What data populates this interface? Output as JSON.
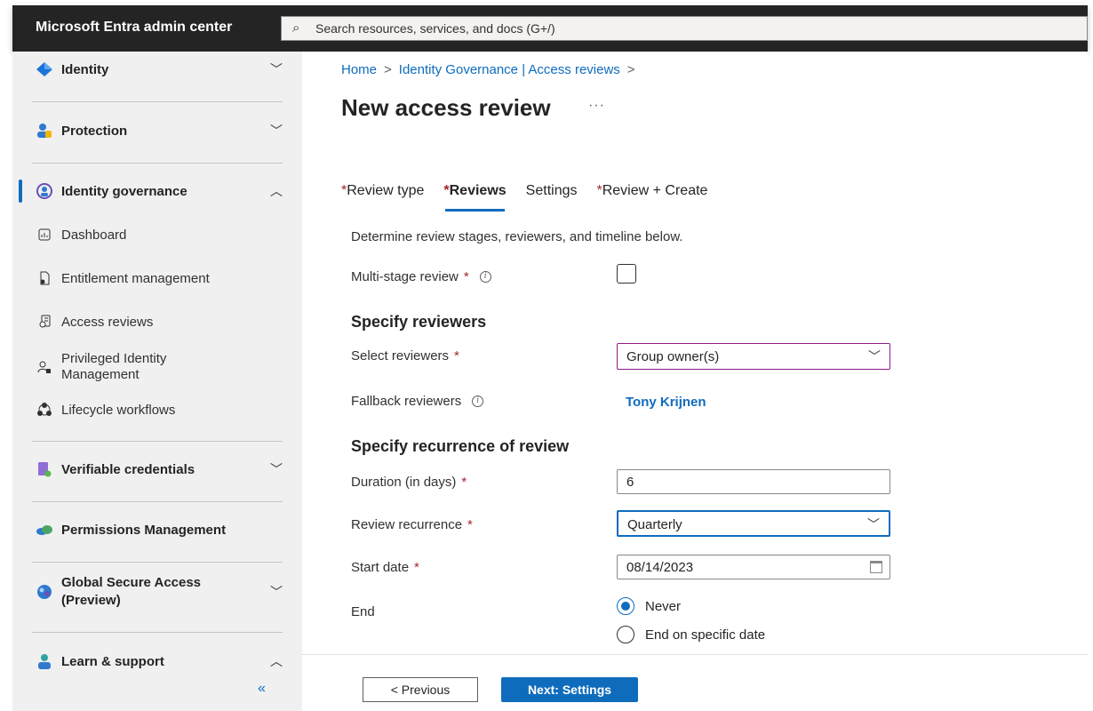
{
  "app": {
    "title": "Microsoft Entra admin center"
  },
  "search": {
    "placeholder": "Search resources, services, and docs (G+/)"
  },
  "sidebar": {
    "items": [
      {
        "label": "Identity",
        "icon": "diamond-icon",
        "expanded": false
      },
      {
        "label": "Protection",
        "icon": "users-shield-icon",
        "expanded": false
      },
      {
        "label": "Identity governance",
        "icon": "governance-icon",
        "expanded": true,
        "active": true
      },
      {
        "label": "Dashboard",
        "icon": "dashboard-icon"
      },
      {
        "label": "Entitlement management",
        "icon": "entitlement-icon"
      },
      {
        "label": "Access reviews",
        "icon": "access-reviews-icon"
      },
      {
        "label": "Privileged Identity Management",
        "icon": "pim-icon"
      },
      {
        "label": "Lifecycle workflows",
        "icon": "lifecycle-icon"
      },
      {
        "label": "Verifiable credentials",
        "icon": "credentials-icon",
        "expanded": false
      },
      {
        "label": "Permissions Management",
        "icon": "cloud-icon"
      },
      {
        "label": "Global Secure Access (Preview)",
        "icon": "globe-icon",
        "expanded": false
      },
      {
        "label": "Learn & support",
        "icon": "person-icon",
        "expanded": true
      }
    ],
    "collapse_glyph": "«"
  },
  "breadcrumb": {
    "home": "Home",
    "sep": ">",
    "parent": "Identity Governance | Access reviews"
  },
  "page": {
    "title": "New access review",
    "more": "···"
  },
  "tabs": [
    {
      "label": "Review type",
      "required": true,
      "active": false
    },
    {
      "label": "Reviews",
      "required": true,
      "active": true
    },
    {
      "label": "Settings",
      "required": false,
      "active": false
    },
    {
      "label": "Review + Create",
      "required": true,
      "active": false
    }
  ],
  "form": {
    "intro": "Determine review stages, reviewers, and timeline below.",
    "multistage_label": "Multi-stage review",
    "multistage_checked": false,
    "reviewers_heading": "Specify reviewers",
    "select_reviewers_label": "Select reviewers",
    "select_reviewers_value": "Group owner(s)",
    "fallback_label": "Fallback reviewers",
    "fallback_value": "Tony Krijnen",
    "recurrence_heading": "Specify recurrence of review",
    "duration_label": "Duration (in days)",
    "duration_value": "6",
    "recurrence_label": "Review recurrence",
    "recurrence_value": "Quarterly",
    "start_label": "Start date",
    "start_value": "08/14/2023",
    "end_label": "End",
    "end_options": [
      {
        "label": "Never",
        "selected": true
      },
      {
        "label": "End on specific date",
        "selected": false
      }
    ],
    "required_mark": "*",
    "info_glyph": "i"
  },
  "footer": {
    "prev_label": "< Previous",
    "next_label": "Next: Settings"
  },
  "colors": {
    "accent": "#0f6cbd",
    "required": "#a4262c",
    "topbar": "#242424",
    "sidebar": "#f0f0f0"
  }
}
